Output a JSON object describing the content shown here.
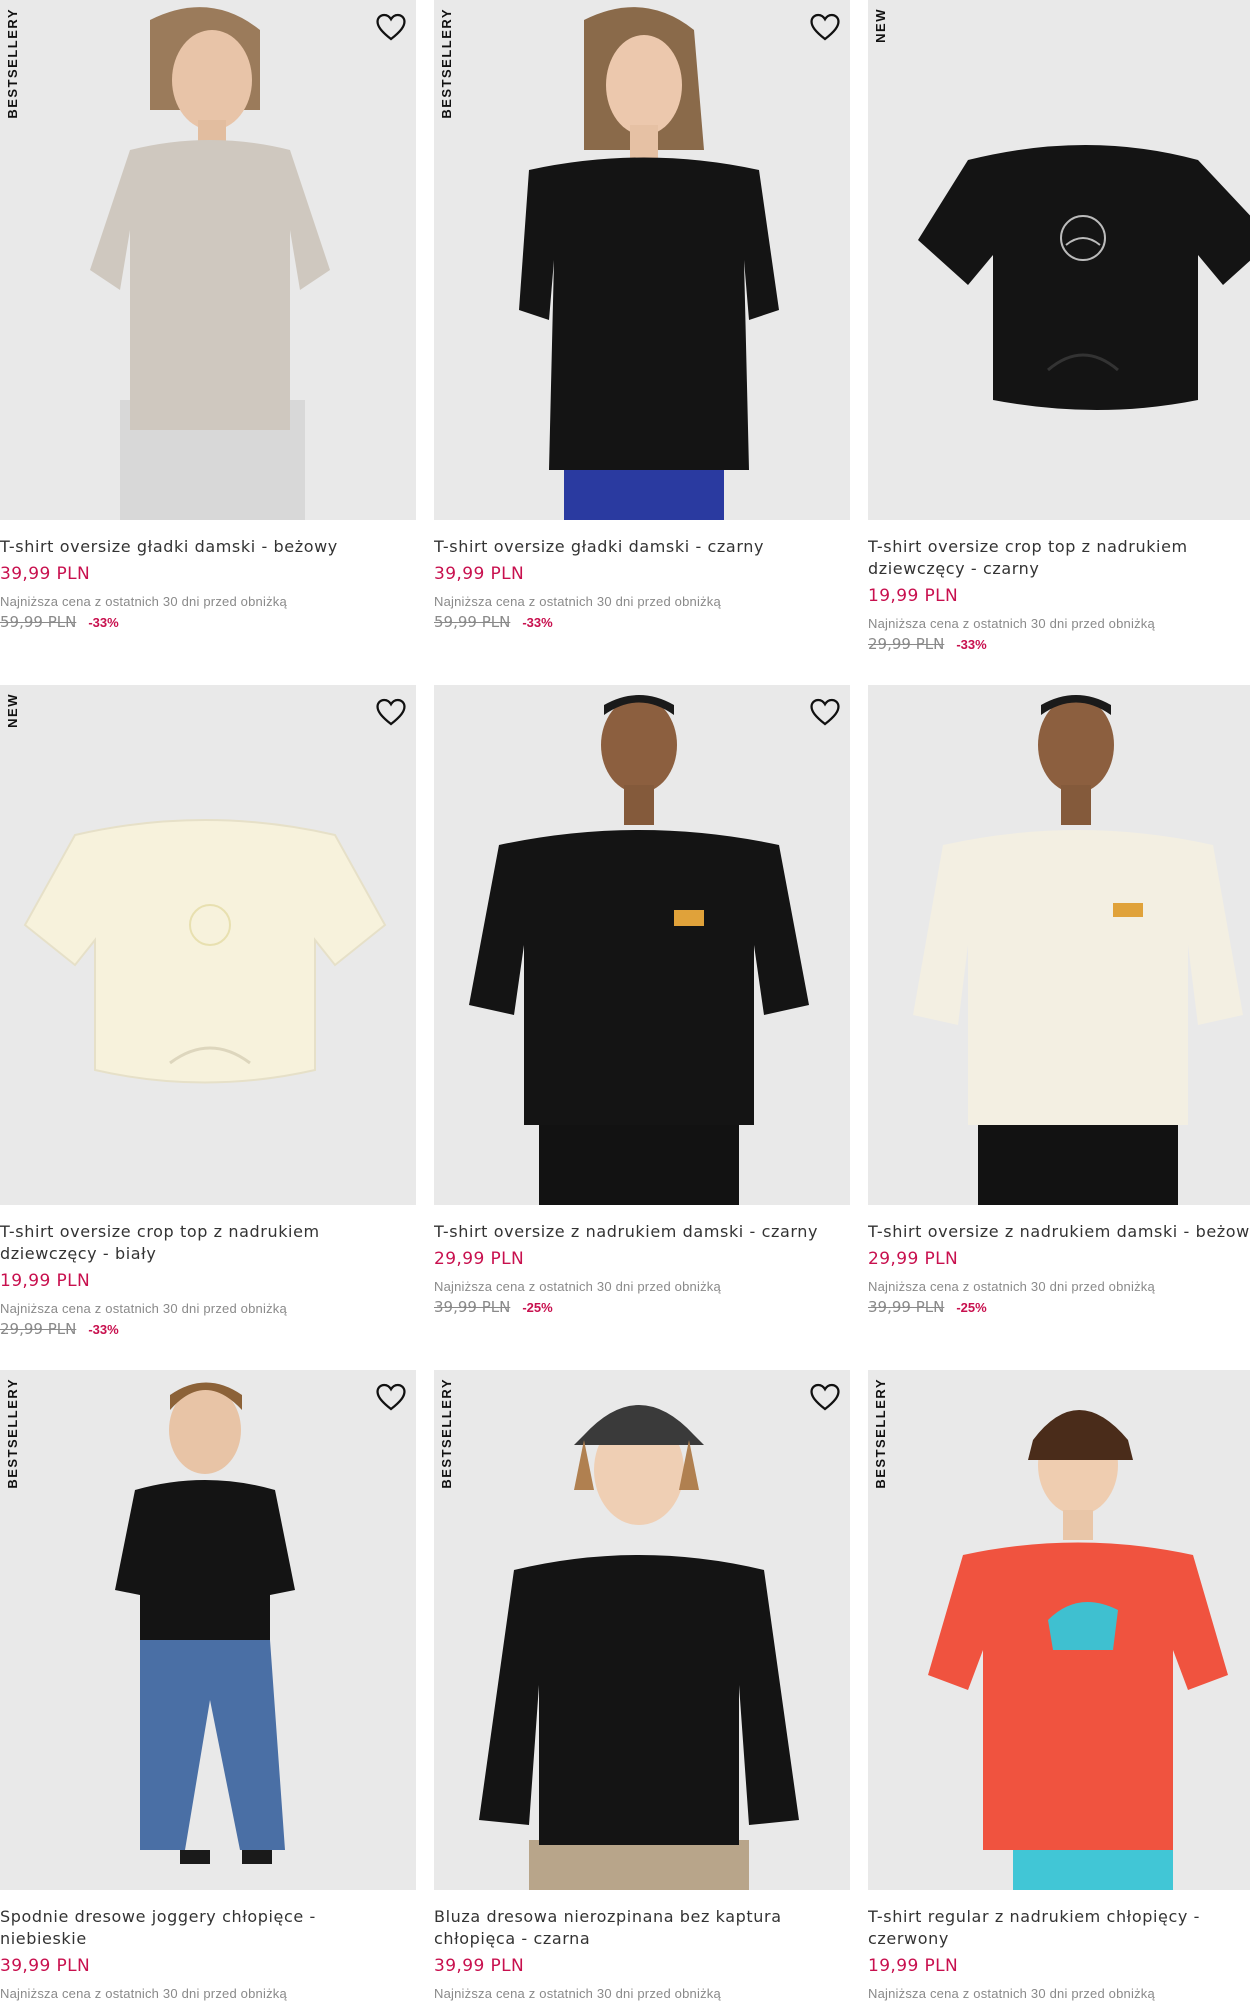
{
  "colors": {
    "price": "#c8104e",
    "muted": "#8a8a8a",
    "image_bg": "#e9e9e9"
  },
  "lowest_label": "Najniższa cena z ostatnich 30 dni przed obniżką",
  "products": [
    {
      "badge": "BESTSELLERY",
      "name1": "T-shirt oversize gładki damski - beżowy",
      "name2": "",
      "price": "39,99 PLN",
      "old_price": "59,99 PLN",
      "discount": "-33%",
      "garment_color": "#cfc8bf",
      "image": "woman-beige-tshirt"
    },
    {
      "badge": "BESTSELLERY",
      "name1": "T-shirt oversize gładki damski - czarny",
      "name2": "",
      "price": "39,99 PLN",
      "old_price": "59,99 PLN",
      "discount": "-33%",
      "garment_color": "#141414",
      "image": "woman-black-tshirt"
    },
    {
      "badge": "NEW",
      "name1": "T-shirt oversize crop top z nadrukiem",
      "name2": "dziewczęcy - czarny",
      "price": "19,99 PLN",
      "old_price": "29,99 PLN",
      "discount": "-33%",
      "garment_color": "#141414",
      "image": "black-crop-top-flat"
    },
    {
      "badge": "NEW",
      "name1": "T-shirt oversize crop top z nadrukiem",
      "name2": "dziewczęcy - biały",
      "price": "19,99 PLN",
      "old_price": "29,99 PLN",
      "discount": "-33%",
      "garment_color": "#f7f2dc",
      "image": "white-crop-top-flat"
    },
    {
      "badge": "",
      "name1": "T-shirt oversize z nadrukiem damski - czarny",
      "name2": "",
      "price": "29,99 PLN",
      "old_price": "39,99 PLN",
      "discount": "-25%",
      "garment_color": "#141414",
      "image": "woman-black-print-tshirt"
    },
    {
      "badge": "",
      "name1": "T-shirt oversize z nadrukiem damski - beżowy",
      "name2": "",
      "price": "29,99 PLN",
      "old_price": "39,99 PLN",
      "discount": "-25%",
      "garment_color": "#f3efe2",
      "image": "woman-cream-print-tshirt"
    },
    {
      "badge": "BESTSELLERY",
      "name1": "Spodnie dresowe joggery chłopięce -",
      "name2": "niebieskie",
      "price": "39,99 PLN",
      "old_price": "",
      "discount": "",
      "garment_color": "#4a6fa5",
      "image": "boy-blue-joggers"
    },
    {
      "badge": "BESTSELLERY",
      "name1": "Bluza dresowa nierozpinana bez kaptura",
      "name2": "chłopięca - czarna",
      "price": "39,99 PLN",
      "old_price": "",
      "discount": "",
      "garment_color": "#141414",
      "image": "boy-black-sweatshirt"
    },
    {
      "badge": "BESTSELLERY",
      "name1": "T-shirt regular z nadrukiem chłopięcy -",
      "name2": "czerwony",
      "price": "19,99 PLN",
      "old_price": "",
      "discount": "",
      "garment_color": "#f0533f",
      "image": "boy-red-tshirt"
    }
  ]
}
